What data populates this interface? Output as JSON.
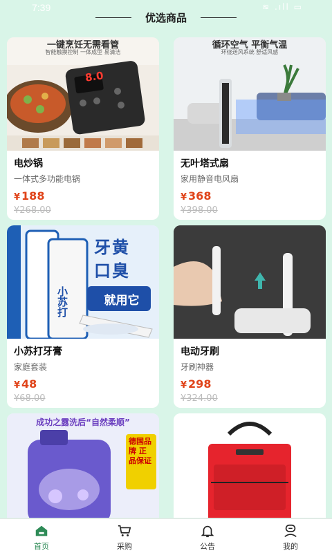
{
  "status": {
    "time": "7:39",
    "icons": "≋ .ıll ▭"
  },
  "header": {
    "title": "优选商品"
  },
  "products": [
    {
      "name": "电炒锅",
      "subtitle": "一体式多功能电锅",
      "price": "188",
      "old_price": "¥268.00",
      "currency": "¥",
      "banner": "一键烹饪无需看管",
      "banner_sub": "智能触摸控制 一体成型 易清洁",
      "display": "8.0"
    },
    {
      "name": "无叶塔式扇",
      "subtitle": "家用静音电风扇",
      "price": "368",
      "old_price": "¥398.00",
      "currency": "¥",
      "banner": "循环空气 平衡气温",
      "banner_sub": "环绕送风系统 舒适风感"
    },
    {
      "name": "小苏打牙膏",
      "subtitle": "家庭套装",
      "price": "48",
      "old_price": "¥68.00",
      "currency": "¥",
      "banner_line1": "牙黄",
      "banner_line2": "口臭",
      "banner_line3": "就用它",
      "tube_text": "小苏打"
    },
    {
      "name": "电动牙刷",
      "subtitle": "牙刷神器",
      "price": "298",
      "old_price": "¥324.00",
      "currency": "¥"
    },
    {
      "name": "",
      "subtitle": "",
      "price": "",
      "old_price": "",
      "currency": "",
      "banner": "成功之露洗后“自然柔顺”",
      "side_badge": "德国品牌 正品保证"
    },
    {
      "name": "",
      "subtitle": "",
      "price": "",
      "old_price": "",
      "currency": ""
    }
  ],
  "tabs": [
    {
      "label": "首页",
      "icon": "home-icon",
      "active": true
    },
    {
      "label": "采购",
      "icon": "cart-icon",
      "active": false
    },
    {
      "label": "公告",
      "icon": "bell-icon",
      "active": false
    },
    {
      "label": "我的",
      "icon": "user-icon",
      "active": false
    }
  ],
  "colors": {
    "background": "#d9f5e8",
    "price": "#e0441a",
    "accent": "#2e8b57"
  }
}
